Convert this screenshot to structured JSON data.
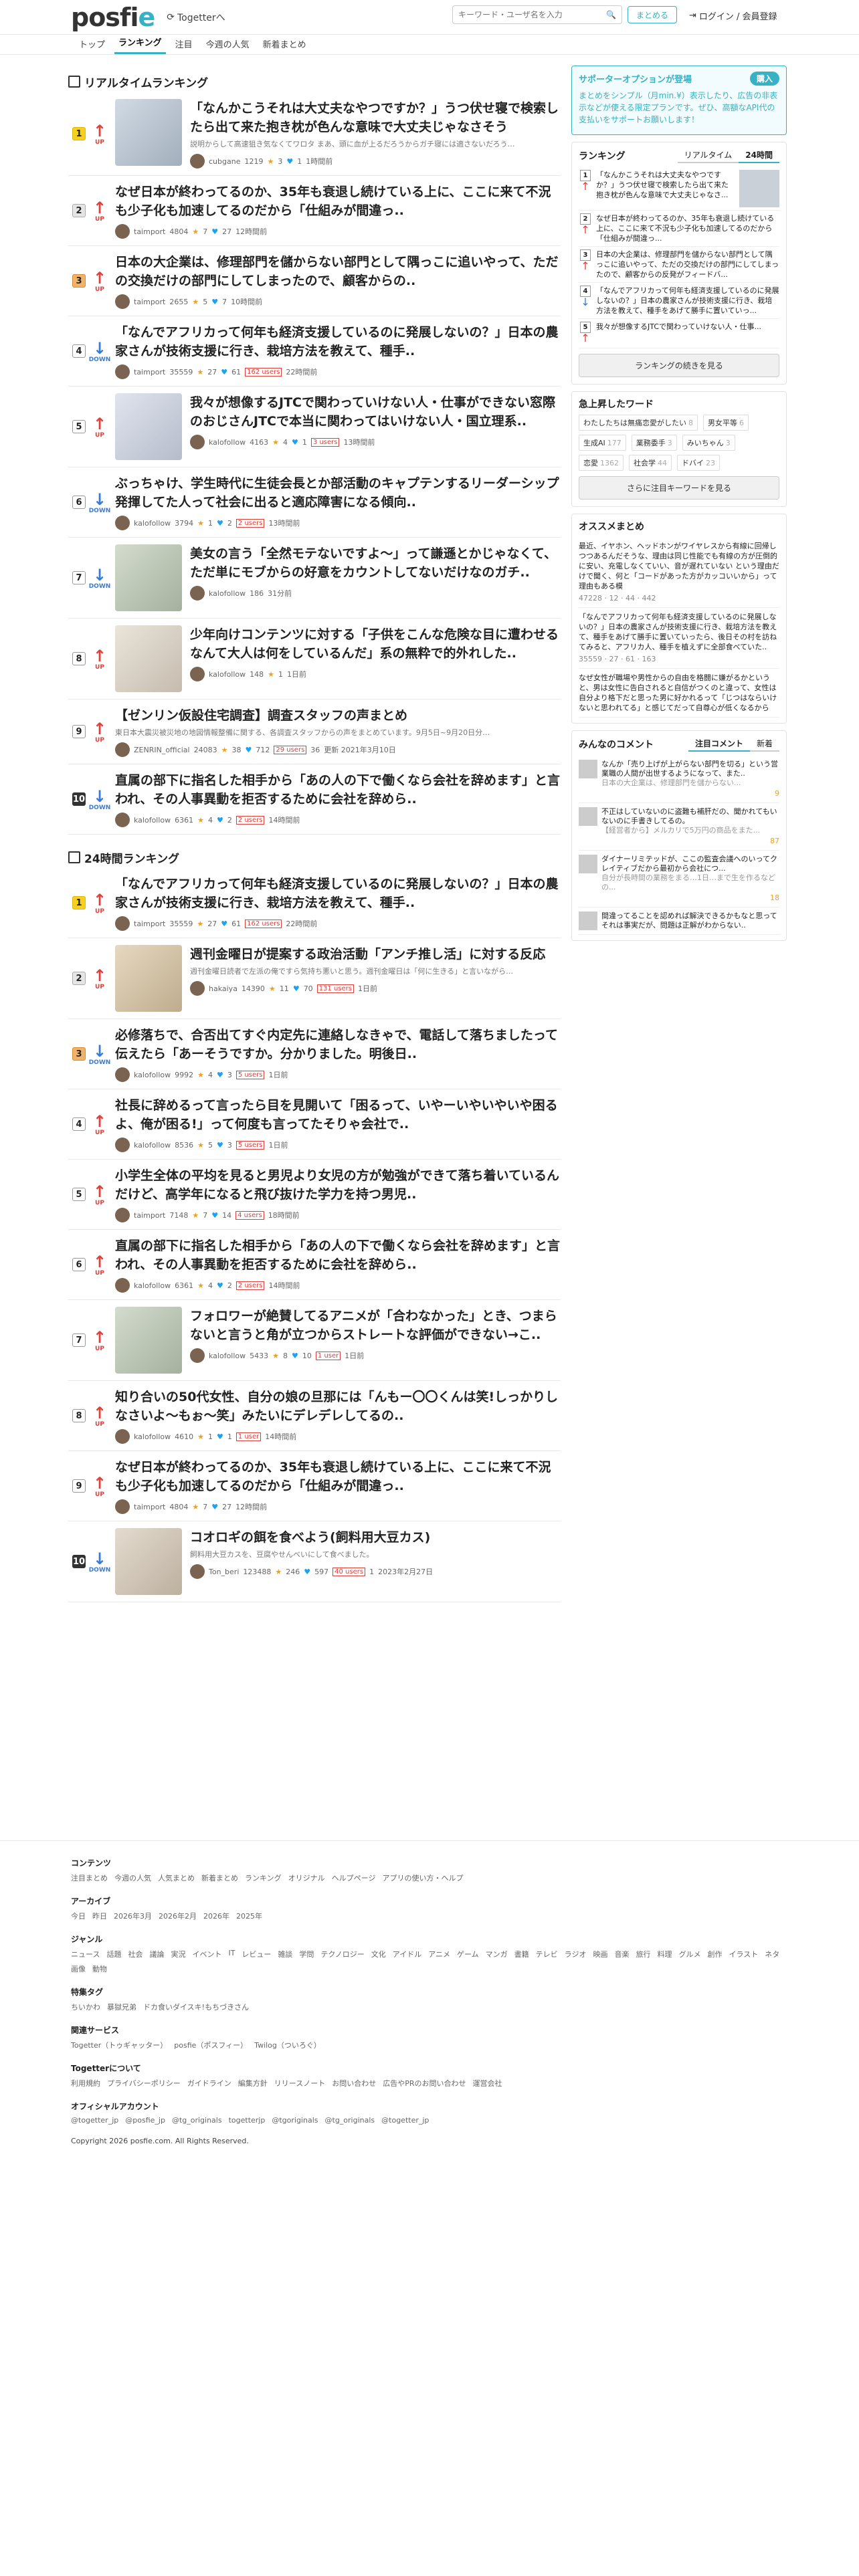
{
  "header": {
    "logo_main": "posfi",
    "logo_accent": "e",
    "togetter_link": "Togetterへ",
    "search_placeholder": "キーワード・ユーザ名を入力",
    "matome_button": "まとめる",
    "login": "ログイン / 会員登録"
  },
  "nav": {
    "tabs": [
      {
        "label": "トップ"
      },
      {
        "label": "ランキング"
      },
      {
        "label": "注目"
      },
      {
        "label": "今週の人気"
      },
      {
        "label": "新着まとめ"
      }
    ]
  },
  "realtime": {
    "heading": "リアルタイムランキング",
    "items": [
      {
        "rank": "1",
        "trend": "UP",
        "title": "「なんかこうそれは大丈夫なやつですか？」うつ伏せ寝で検索したら出て来た抱き枕が色んな意味で大丈夫じゃなさそう",
        "desc": "説明からして高速狙き気なくてワロタ まあ、頭に血が上るだろうからガチ寝には適さないだろう…",
        "user": "cubgane",
        "score": "1219",
        "fav": "3",
        "tw": "1",
        "time": "1時間前",
        "has_thumb": true
      },
      {
        "rank": "2",
        "trend": "UP",
        "title": "なぜ日本が終わってるのか、35年も衰退し続けている上に、ここに来て不況も少子化も加速してるのだから「仕組みが間違っ..",
        "user": "taimport",
        "score": "4804",
        "fav": "7",
        "tw": "27",
        "time": "12時間前",
        "has_thumb": false
      },
      {
        "rank": "3",
        "trend": "UP",
        "title": "日本の大企業は、修理部門を儲からない部門として隅っこに追いやって、ただの交換だけの部門にしてしまったので、顧客からの..",
        "user": "taimport",
        "score": "2655",
        "fav": "5",
        "tw": "7",
        "time": "10時間前",
        "has_thumb": false
      },
      {
        "rank": "4",
        "trend": "DOWN",
        "title": "「なんでアフリカって何年も経済支援しているのに発展しないの？」日本の農家さんが技術支援に行き、栽培方法を教えて、種手..",
        "user": "taimport",
        "score": "35559",
        "fav": "27",
        "tw": "61",
        "users": "162 users",
        "time": "22時間前",
        "has_thumb": false
      },
      {
        "rank": "5",
        "trend": "UP",
        "title": "我々が想像するJTCで関わっていけない人・仕事ができない窓際のおじさんJTCで本当に関わってはいけない人・国立理系..",
        "user": "kalofollow",
        "score": "4163",
        "fav": "4",
        "tw": "1",
        "users": "3 users",
        "time": "13時間前",
        "has_thumb": true
      },
      {
        "rank": "6",
        "trend": "DOWN",
        "title": "ぶっちゃけ、学生時代に生徒会長とか部活動のキャプテンするリーダーシップ発揮してた人って社会に出ると適応障害になる傾向..",
        "user": "kalofollow",
        "score": "3794",
        "fav": "1",
        "tw": "2",
        "users": "2 users",
        "time": "13時間前",
        "has_thumb": false
      },
      {
        "rank": "7",
        "trend": "DOWN",
        "title": "美女の言う「全然モテないですよ～」って謙遜とかじゃなくて、ただ単にモブからの好意をカウントしてないだけなのガチ..",
        "user": "kalofollow",
        "score": "186",
        "fav": "",
        "tw": "",
        "time": "31分前",
        "has_thumb": true
      },
      {
        "rank": "8",
        "trend": "UP",
        "title": "少年向けコンテンツに対する「子供をこんな危険な目に遭わせるなんて大人は何をしているんだ」系の無粋で的外れした..",
        "user": "kalofollow",
        "score": "148",
        "fav": "1",
        "tw": "",
        "time": "1日前",
        "has_thumb": true
      },
      {
        "rank": "9",
        "trend": "UP",
        "title": "【ゼンリン仮設住宅調査】調査スタッフの声まとめ",
        "desc": "東日本大震災被災地の地図情報整備に関する、各調査スタッフからの声をまとめています。9月5日~9月20日分…",
        "user": "ZENRIN_official",
        "score": "24083",
        "fav": "38",
        "tw": "712",
        "users": "29 users",
        "extra": "36",
        "time": "更新 2021年3月10日",
        "has_thumb": false
      },
      {
        "rank": "10",
        "trend": "DOWN",
        "title": "直属の部下に指名した相手から「あの人の下で働くなら会社を辞めます」と言われ、その人事異動を拒否するために会社を辞めら..",
        "user": "kalofollow",
        "score": "6361",
        "fav": "4",
        "tw": "2",
        "users": "2 users",
        "time": "14時間前",
        "has_thumb": false
      }
    ]
  },
  "daily": {
    "heading": "24時間ランキング",
    "items": [
      {
        "rank": "1",
        "trend": "UP",
        "title": "「なんでアフリカって何年も経済支援しているのに発展しないの？」日本の農家さんが技術支援に行き、栽培方法を教えて、種手..",
        "user": "taimport",
        "score": "35559",
        "fav": "27",
        "tw": "61",
        "users": "162 users",
        "time": "22時間前",
        "has_thumb": false
      },
      {
        "rank": "2",
        "trend": "UP",
        "title": "週刊金曜日が提案する政治活動「アンチ推し活」に対する反応",
        "desc": "週刊金曜日読者で左派の俺ですら気持ち悪いと思う。週刊金曜日は「何に生きる」と言いながら…",
        "user": "hakaiya",
        "score": "14390",
        "fav": "11",
        "tw": "70",
        "users": "131 users",
        "time": "1日前",
        "has_thumb": true
      },
      {
        "rank": "3",
        "trend": "DOWN",
        "title": "必修落ちで、合否出てすぐ内定先に連絡しなきゃで、電話して落ちましたって伝えたら「あーそうですか。分かりました。明後日..",
        "user": "kalofollow",
        "score": "9992",
        "fav": "4",
        "tw": "3",
        "users": "5 users",
        "time": "1日前",
        "has_thumb": false
      },
      {
        "rank": "4",
        "trend": "UP",
        "title": "社長に辞めるって言ったら目を見開いて「困るって、いやーいやいやいや困るよ、俺が困る!」って何度も言ってたそりゃ会社で..",
        "user": "kalofollow",
        "score": "8536",
        "fav": "5",
        "tw": "3",
        "users": "5 users",
        "time": "1日前",
        "has_thumb": false
      },
      {
        "rank": "5",
        "trend": "UP",
        "title": "小学生全体の平均を見ると男児より女児の方が勉強ができて落ち着いているんだけど、高学年になると飛び抜けた学力を持つ男児..",
        "user": "taimport",
        "score": "7148",
        "fav": "7",
        "tw": "14",
        "users": "4 users",
        "time": "18時間前",
        "has_thumb": false
      },
      {
        "rank": "6",
        "trend": "UP",
        "title": "直属の部下に指名した相手から「あの人の下で働くなら会社を辞めます」と言われ、その人事異動を拒否するために会社を辞めら..",
        "user": "kalofollow",
        "score": "6361",
        "fav": "4",
        "tw": "2",
        "users": "2 users",
        "time": "14時間前",
        "has_thumb": false
      },
      {
        "rank": "7",
        "trend": "UP",
        "title": "フォロワーが絶賛してるアニメが「合わなかった」とき、つまらないと言うと角が立つからストレートな評価ができない→こ..",
        "user": "kalofollow",
        "score": "5433",
        "fav": "8",
        "tw": "10",
        "users": "1 user",
        "time": "1日前",
        "has_thumb": true
      },
      {
        "rank": "8",
        "trend": "UP",
        "title": "知り合いの50代女性、自分の娘の旦那には「んもー〇〇くんは笑!しっかりしなさいよ～もぉ～笑」みたいにデレデレしてるの..",
        "user": "kalofollow",
        "score": "4610",
        "fav": "1",
        "tw": "1",
        "users": "1 user",
        "time": "14時間前",
        "has_thumb": false
      },
      {
        "rank": "9",
        "trend": "UP",
        "title": "なぜ日本が終わってるのか、35年も衰退し続けている上に、ここに来て不況も少子化も加速してるのだから「仕組みが間違っ..",
        "user": "taimport",
        "score": "4804",
        "fav": "7",
        "tw": "27",
        "time": "12時間前",
        "has_thumb": false
      },
      {
        "rank": "10",
        "trend": "DOWN",
        "title": "コオロギの餌を食べよう(飼料用大豆カス)",
        "desc": "飼料用大豆カスを、豆腐やせんべいにして食べました。",
        "user": "Ton_beri",
        "score": "123488",
        "fav": "246",
        "tw": "597",
        "users": "40 users",
        "extra": "1",
        "time": "2023年2月27日",
        "has_thumb": true
      }
    ]
  },
  "sidebar": {
    "support": {
      "title": "サポーターオプションが登場",
      "buy": "購入",
      "text": "まとめをシンプル（月min.¥）表示したり、広告の非表示などが使える限定プランです。ぜひ、高額なAPI代の支払いをサポートお願いします！"
    },
    "ranking": {
      "heading": "ランキング",
      "tab1": "リアルタイム",
      "tab2": "24時間",
      "items": [
        {
          "n": "1",
          "trend": "UP",
          "text": "「なんかこうそれは大丈夫なやつですか？」うつ伏せ寝で検索したら出て来た抱き枕が色んな意味で大丈夫じゃなさ..."
        },
        {
          "n": "2",
          "trend": "UP",
          "text": "なぜ日本が終わってるのか、35年も衰退し続けている上に、ここに来て不況も少子化も加速してるのだから「仕組みが間違っ..."
        },
        {
          "n": "3",
          "trend": "UP",
          "text": "日本の大企業は、修理部門を儲からない部門として隅っこに追いやって、ただの交換だけの部門にしてしまったので、顧客からの反発がフィードバ..."
        },
        {
          "n": "4",
          "trend": "DOWN",
          "text": "「なんでアフリカって何年も経済支援しているのに発展しないの？」日本の農家さんが技術支援に行き、栽培方法を教えて、種手をあげて勝手に置いていっ..."
        },
        {
          "n": "5",
          "trend": "UP",
          "text": "我々が想像するJTCで関わっていけない人・仕事..."
        }
      ],
      "more": "ランキングの続きを見る"
    },
    "keywords": {
      "heading": "急上昇したワード",
      "items": [
        {
          "w": "わたしたちは無痛恋愛がしたい",
          "c": "8"
        },
        {
          "w": "男女平等",
          "c": "6"
        },
        {
          "w": "生成AI",
          "c": "177"
        },
        {
          "w": "業務委手",
          "c": "3"
        },
        {
          "w": "みいちゃん",
          "c": "3"
        },
        {
          "w": "恋愛",
          "c": "1362"
        },
        {
          "w": "社会学",
          "c": "44"
        },
        {
          "w": "ドバイ",
          "c": "23"
        }
      ],
      "more": "さらに注目キーワードを見る"
    },
    "osusume": {
      "heading": "オススメまとめ",
      "items": [
        {
          "text": "最近、イヤホン、ヘッドホンがワイヤレスから有線に回帰しつつあるんだそうな、理由は同じ性能でも有線の方が圧倒的に安い、充電しなくていい、音が遅れていない という理由だけで聞く、何と「コードがあった方がカッコいいから」って理由もある模",
          "m": "47228 · 12 · 44 · 442"
        },
        {
          "text": "「なんでアフリカって何年も経済支援しているのに発展しないの？」日本の農家さんが技術支援に行き、栽培方法を教えて、種手をあげて勝手に置いていったら、後日その村を訪ねてみると、アフリカ人、種手を植えずに全部食べていた..",
          "m": "35559 · 27 · 61 · 163"
        },
        {
          "text": "なぜ女性が職場や男性からの自由を格闘に嫌がるかというと、男は女性に告白されると自信がつくのと違って、女性は自分より格下だと思った男に好かれるって「じつはならいけないと思われてる」と感じてだって自尊心が低くなるから",
          "m": ""
        }
      ]
    },
    "comments": {
      "heading": "みんなのコメント",
      "tab1": "注目コメント",
      "tab2": "新着",
      "items": [
        {
          "title": "なんか「売り上げが上がらない部門を切る」という営業職の人間が出世するようになって、また..",
          "sub": "日本の大企業は、修理部門を儲からない...",
          "cnt": "9"
        },
        {
          "title": "不正はしていないのに盗難も補肝だの、聞かれてもいないのに手書きしてるの。",
          "sub": "【経営者から】メルカリで5万円の商品をまた...",
          "cnt": "87"
        },
        {
          "title": "ダイナーリミテッドが、ここの監査会議へのいってクレイティブだから最初から会社につ...",
          "sub": "自分が長時間の業務をまる…1日…まで生を作るなどの...",
          "cnt": "18"
        },
        {
          "title": "間違ってることを認めれば解決できるかもなと思ってそれは事実だが、問題は正解がわからない..",
          "sub": "",
          "cnt": ""
        }
      ]
    }
  },
  "footer": {
    "sections": [
      {
        "h": "コンテンツ",
        "links": [
          "注目まとめ",
          "今週の人気",
          "人気まとめ",
          "新着まとめ",
          "ランキング",
          "オリジナル",
          "ヘルプページ",
          "アプリの使い方・ヘルプ"
        ]
      },
      {
        "h": "アーカイブ",
        "links": [
          "今日",
          "昨日",
          "2026年3月",
          "2026年2月",
          "2026年",
          "2025年"
        ]
      },
      {
        "h": "ジャンル",
        "links": [
          "ニュース",
          "話題",
          "社会",
          "議論",
          "実況",
          "イベント",
          "IT",
          "レビュー",
          "雑談",
          "学問",
          "テクノロジー",
          "文化",
          "アイドル",
          "アニメ",
          "ゲーム",
          "マンガ",
          "書籍",
          "テレビ",
          "ラジオ",
          "映画",
          "音楽",
          "旅行",
          "料理",
          "グルメ",
          "創作",
          "イラスト",
          "ネタ",
          "画像",
          "動物"
        ]
      },
      {
        "h": "特集タグ",
        "links": [
          "ちいかわ",
          "暴獄兄弟",
          "ドカ食いダイスキ!もちづきさん"
        ]
      },
      {
        "h": "関連サービス",
        "links": [
          "Togetter（トゥギャッター）",
          "posfie（ポスフィー）",
          "Twilog（ついろぐ）"
        ]
      },
      {
        "h": "Togetterについて",
        "links": [
          "利用規約",
          "プライバシーポリシー",
          "ガイドライン",
          "編集方針",
          "リリースノート",
          "お問い合わせ",
          "広告やPRのお問い合わせ",
          "運営会社"
        ]
      },
      {
        "h": "オフィシャルアカウント",
        "links": [
          "@togetter_jp",
          "@posfie_jp",
          "@tg_originals",
          "togetterjp",
          "@tgoriginals",
          "@tg_originals",
          "@togetter_jp"
        ]
      }
    ],
    "copyright": "Copyright 2026 posfie.com. All Rights Reserved."
  }
}
